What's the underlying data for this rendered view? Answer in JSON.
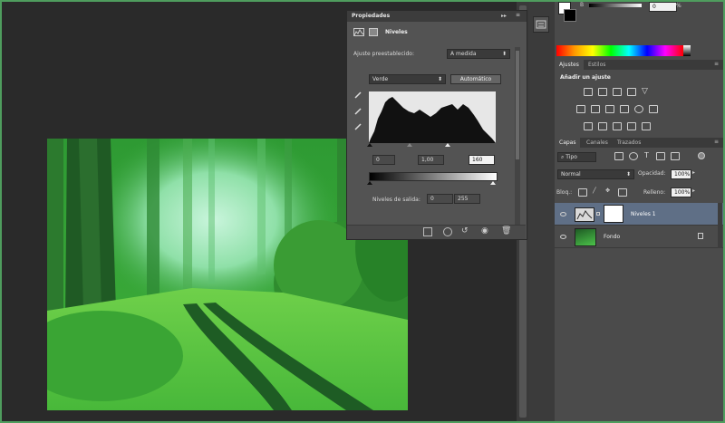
{
  "properties_panel": {
    "title": "Propiedades",
    "collapse_glyph": "▸▸",
    "menu_glyph": "≡",
    "section_title": "Niveles",
    "preset_label": "Ajuste preestablecido:",
    "preset_value": "A medida",
    "channel_value": "Verde",
    "auto_button": "Automático",
    "input_shadows": "0",
    "input_midtones": "1,00",
    "input_highlights": "160",
    "output_label": "Niveles de salida:",
    "output_black": "0",
    "output_white": "255"
  },
  "adjustments_panel": {
    "tab_active": "Ajustes",
    "tab_other": "Estilos",
    "add_label": "Añadir un ajuste"
  },
  "layers_panel": {
    "tabs": [
      "Capas",
      "Canales",
      "Trazados"
    ],
    "filter_value": "Tipo",
    "blend_mode": "Normal",
    "opacity_label": "Opacidad:",
    "opacity_value": "100%",
    "lock_label": "Bloq.:",
    "fill_label": "Relleno:",
    "fill_value": "100%",
    "layers": [
      {
        "name": "Niveles 1",
        "selected": true
      },
      {
        "name": "Fondo",
        "selected": false
      }
    ]
  },
  "color_panel": {
    "field1_value": "0",
    "field2_value": "%"
  },
  "colors": {
    "accent_border": "#4f9d5e",
    "selected_layer": "#5f6f86"
  }
}
